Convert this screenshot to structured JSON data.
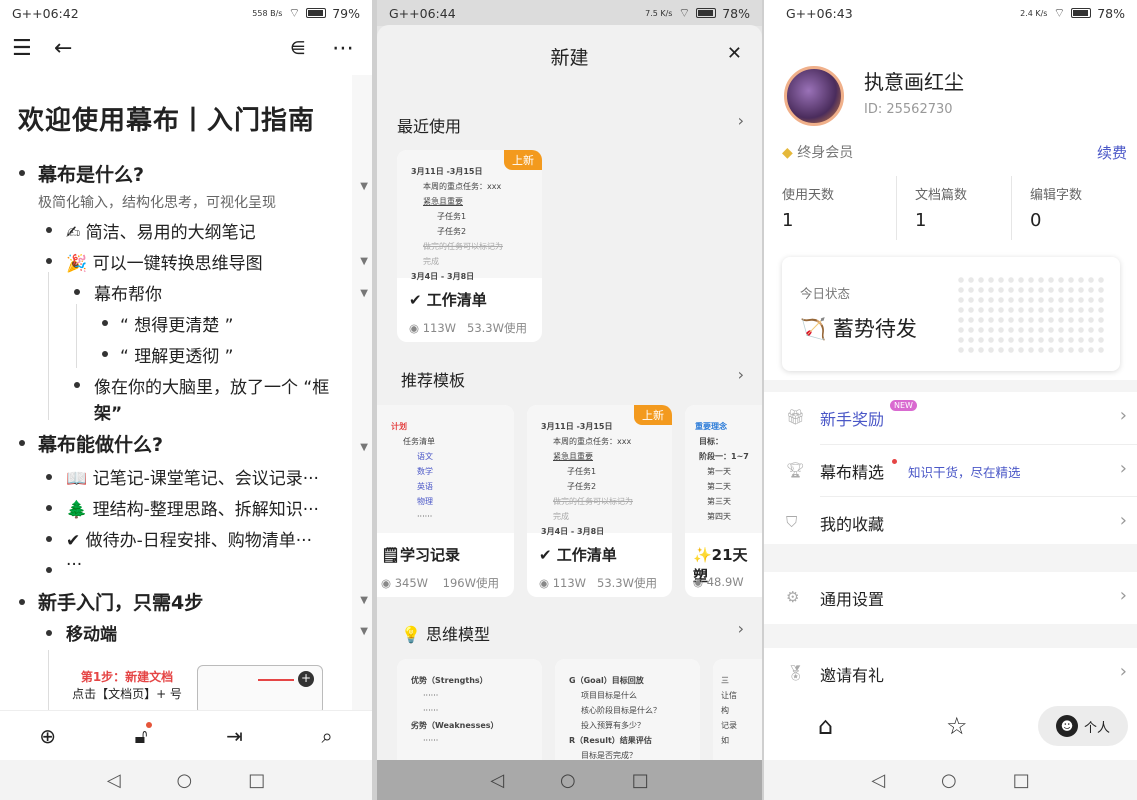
{
  "p1": {
    "status_time": "G++06:42",
    "status_speed": "558 B/s",
    "status_battery": "79%",
    "title": "欢迎使用幕布丨入门指南",
    "lines": [
      "幕布是什么?",
      "极简化输入，结构化思考，可视化呈现",
      "✍ 简洁、易用的大纲笔记",
      "🎉 可以一键转换思维导图",
      "幕布帮你",
      "“ 想得更清楚 ”",
      "“ 理解更透彻 ”",
      "像在你的大脑里，放了一个 “框",
      "架”",
      "幕布能做什么?",
      "📖 记笔记-课堂笔记、会议记录···",
      "🌲 理结构-整理思路、拆解知识···",
      "✔ 做待办-日程安排、购物清单···",
      "···",
      "新手入门，只需4步",
      "移动端"
    ],
    "step_title": "第1步：新建文档",
    "step_desc": "点击【文档页】+ 号"
  },
  "p2": {
    "status_time": "G++06:44",
    "status_speed": "7.5 K/s",
    "status_battery": "78%",
    "title": "新建",
    "close": "✕",
    "recent_label": "最近使用",
    "recommend_label": "推荐模板",
    "model_label": "思维模型",
    "new_tag": "上新",
    "recent": {
      "name": "✔ 工作清单",
      "views": "113W",
      "uses": "53.3W使用",
      "prev": [
        "3月11日 -3月15日",
        "本周的重点任务：xxx",
        "紧急且重要",
        "子任务1",
        "子任务2",
        "做完的任务可以标记为",
        "完成",
        "3月4日 - 3月8日"
      ]
    },
    "templates": [
      {
        "name": "🗒学习记录",
        "views": "345W",
        "uses": "196W使用",
        "prev": [
          "计划",
          "任务清单",
          "语文",
          "数学",
          "英语",
          "物理",
          "······"
        ]
      },
      {
        "name": "✔ 工作清单",
        "views": "113W",
        "uses": "53.3W使用",
        "prev": [
          "3月11日 -3月15日",
          "本周的重点任务：xxx",
          "紧急且重要",
          "子任务1",
          "子任务2",
          "做完的任务可以标记为",
          "完成",
          "3月4日 - 3月8日"
        ]
      },
      {
        "name": "✨21天塑",
        "views": "48.9W",
        "uses": "",
        "prev": [
          "重要理念",
          "目标：",
          "阶段一：1~7",
          "第一天",
          "第二天",
          "第三天",
          "第四天"
        ]
      }
    ],
    "models": [
      {
        "prev": [
          "优势（Strengths）",
          "······",
          "······",
          "劣势（Weaknesses）",
          "······"
        ]
      },
      {
        "prev": [
          "G（Goal）目标回放",
          "项目目标是什么",
          "核心阶段目标是什么？",
          "投入预算有多少？",
          "R（Result）结果评估",
          "目标是否完成？"
        ]
      },
      {
        "prev": [
          "三",
          "让信",
          "构",
          "记录",
          "如"
        ]
      }
    ]
  },
  "p3": {
    "status_time": "G++06:43",
    "status_speed": "2.4 K/s",
    "status_battery": "78%",
    "username": "执意画红尘",
    "user_id": "ID: 25562730",
    "member": "终身会员",
    "renew": "续费",
    "stats": [
      {
        "label": "使用天数",
        "value": "1"
      },
      {
        "label": "文档篇数",
        "value": "1"
      },
      {
        "label": "编辑字数",
        "value": "0"
      }
    ],
    "today_label": "今日状态",
    "today_status": "🏹 蓄势待发",
    "menu": [
      {
        "label": "新手奖励",
        "tag": "NEW"
      },
      {
        "label": "幕布精选",
        "sub": "知识干货，尽在精选"
      },
      {
        "label": "我的收藏"
      }
    ],
    "settings": "通用设置",
    "invite": "邀请有礼",
    "tab_me": "个人"
  },
  "colors": {
    "accent": "#4a57c7",
    "new_tag": "#f39a1e",
    "red_text": "#e54545"
  }
}
